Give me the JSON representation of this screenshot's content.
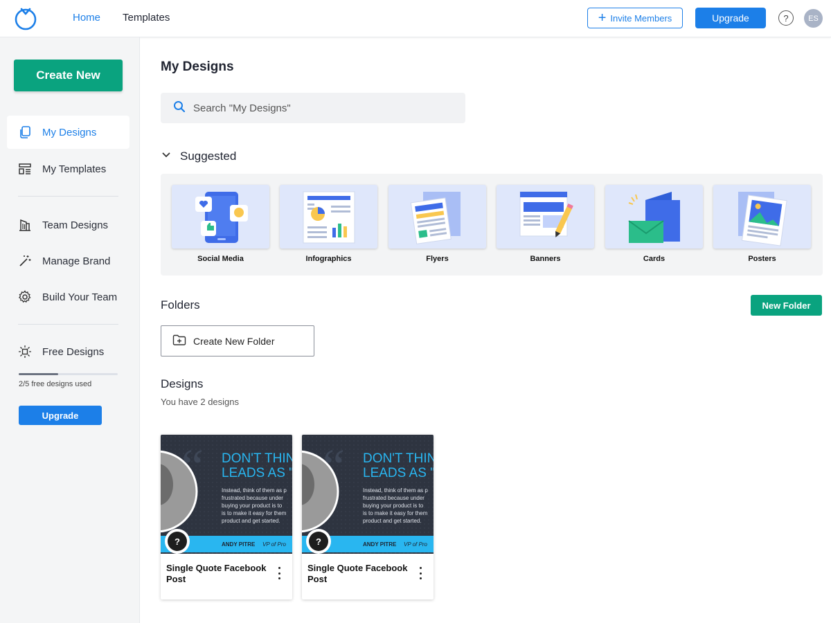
{
  "colors": {
    "accent": "#1c7fe8",
    "brand_green": "#0aa37f",
    "thumb_bg": "#2e3440",
    "quote_blue": "#29b6f0"
  },
  "topbar": {
    "nav": [
      {
        "label": "Home",
        "active": true
      },
      {
        "label": "Templates",
        "active": false
      }
    ],
    "invite_label": "Invite Members",
    "upgrade_label": "Upgrade",
    "help_glyph": "?",
    "avatar_initials": "ES"
  },
  "sidebar": {
    "create_label": "Create New",
    "items": [
      {
        "label": "My Designs",
        "icon": "copy-icon",
        "active": true
      },
      {
        "label": "My Templates",
        "icon": "layout-icon",
        "active": false
      },
      {
        "label": "Team Designs",
        "icon": "building-icon",
        "active": false
      },
      {
        "label": "Manage Brand",
        "icon": "magic-wand-icon",
        "active": false
      },
      {
        "label": "Build Your Team",
        "icon": "gear-icon",
        "active": false
      },
      {
        "label": "Free Designs",
        "icon": "sun-icon",
        "active": false
      }
    ],
    "progress": {
      "used": 2,
      "total": 5,
      "fraction": 0.4,
      "label": "2/5 free designs used"
    },
    "upgrade_label": "Upgrade"
  },
  "main": {
    "title": "My Designs",
    "search": {
      "placeholder": "Search \"My Designs\""
    },
    "suggested": {
      "heading": "Suggested",
      "items": [
        {
          "label": "Social Media",
          "icon": "social-media-icon"
        },
        {
          "label": "Infographics",
          "icon": "infographics-icon"
        },
        {
          "label": "Flyers",
          "icon": "flyers-icon"
        },
        {
          "label": "Banners",
          "icon": "banners-icon"
        },
        {
          "label": "Cards",
          "icon": "cards-icon"
        },
        {
          "label": "Posters",
          "icon": "posters-icon"
        }
      ]
    },
    "folders": {
      "heading": "Folders",
      "new_folder_label": "New Folder",
      "create_folder_label": "Create New Folder"
    },
    "designs": {
      "heading": "Designs",
      "count_text": "You have 2 designs",
      "items": [
        {
          "name": "Single Quote Facebook Post",
          "thumb": {
            "headline_1": "DON'T THINK O",
            "headline_2": "LEADS AS \"LEA",
            "body": [
              "Instead, think of them as p",
              "frustrated because under",
              "buying your product is to",
              "is to make it easy for them",
              "product and get started."
            ],
            "author": "ANDY PITRE",
            "role": "VP of Pro"
          }
        },
        {
          "name": "Single Quote Facebook Post",
          "thumb": {
            "headline_1": "DON'T THINK O",
            "headline_2": "LEADS AS \"LEA",
            "body": [
              "Instead, think of them as p",
              "frustrated because under",
              "buying your product is to",
              "is to make it easy for them",
              "product and get started."
            ],
            "author": "ANDY PITRE",
            "role": "VP of Pro"
          }
        }
      ]
    }
  }
}
